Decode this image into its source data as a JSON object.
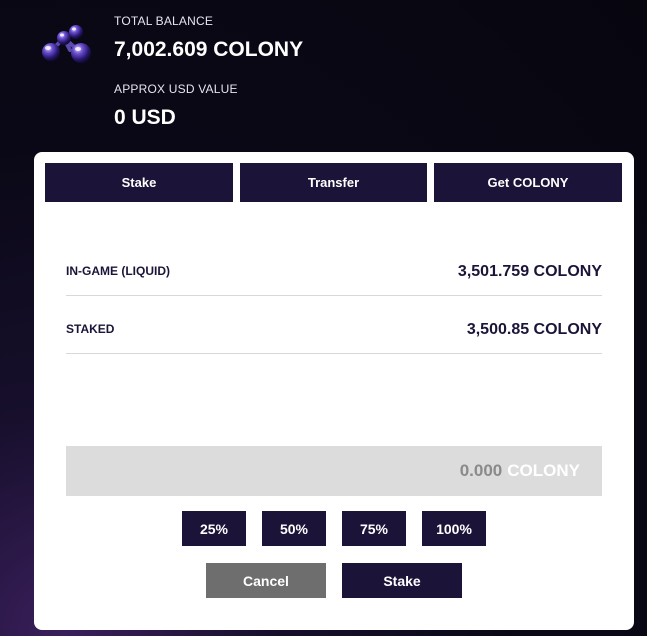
{
  "header": {
    "total_balance_label": "TOTAL BALANCE",
    "total_balance_value": "7,002.609 COLONY",
    "usd_label": "APPROX USD VALUE",
    "usd_value": "0 USD",
    "logo_icon": "colony-token-icon"
  },
  "tabs": [
    {
      "label": "Stake"
    },
    {
      "label": "Transfer"
    },
    {
      "label": "Get COLONY"
    }
  ],
  "balances": [
    {
      "label": "IN-GAME (LIQUID)",
      "value": "3,501.759 COLONY"
    },
    {
      "label": "STAKED",
      "value": "3,500.85 COLONY"
    }
  ],
  "amount_input": {
    "value": "0.000",
    "unit": "COLONY"
  },
  "percent_buttons": [
    {
      "label": "25%"
    },
    {
      "label": "50%"
    },
    {
      "label": "75%"
    },
    {
      "label": "100%"
    }
  ],
  "actions": {
    "cancel_label": "Cancel",
    "confirm_label": "Stake"
  },
  "colors": {
    "background": "#0a0816",
    "accent_navy": "#1c1438",
    "cancel_gray": "#6e6e6e",
    "input_gray": "#dcdcdc",
    "card": "#ffffff"
  }
}
